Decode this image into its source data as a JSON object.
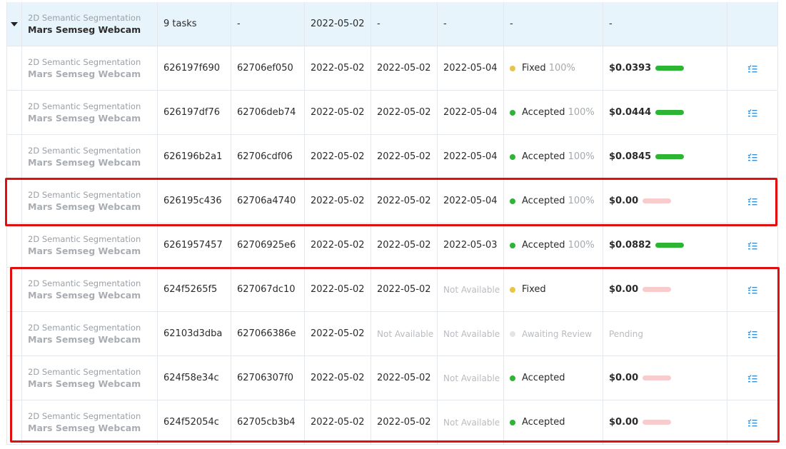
{
  "group": {
    "project_type": "2D Semantic Segmentation",
    "project_name": "Mars Semseg Webcam",
    "tasks": "9 tasks",
    "c3": "-",
    "created": "2022-05-02",
    "c5": "-",
    "c6": "-",
    "c7": "-",
    "c8": "-"
  },
  "rows": [
    {
      "project_type": "2D Semantic Segmentation",
      "project_name": "Mars Semseg Webcam",
      "task_id": "626197f690",
      "annotation_id": "62706ef050",
      "created": "2022-05-02",
      "submitted": "2022-05-02",
      "reviewed": "2022-05-04",
      "status": "Fixed",
      "percent": "100%",
      "status_color": "#e8c547",
      "price": "$0.0393",
      "bar_fill": 1,
      "bar_color": "#2bb532"
    },
    {
      "project_type": "2D Semantic Segmentation",
      "project_name": "Mars Semseg Webcam",
      "task_id": "626197df76",
      "annotation_id": "62706deb74",
      "created": "2022-05-02",
      "submitted": "2022-05-02",
      "reviewed": "2022-05-04",
      "status": "Accepted",
      "percent": "100%",
      "status_color": "#2bb532",
      "price": "$0.0444",
      "bar_fill": 1,
      "bar_color": "#2bb532"
    },
    {
      "project_type": "2D Semantic Segmentation",
      "project_name": "Mars Semseg Webcam",
      "task_id": "626196b2a1",
      "annotation_id": "62706cdf06",
      "created": "2022-05-02",
      "submitted": "2022-05-02",
      "reviewed": "2022-05-04",
      "status": "Accepted",
      "percent": "100%",
      "status_color": "#2bb532",
      "price": "$0.0845",
      "bar_fill": 1,
      "bar_color": "#2bb532"
    },
    {
      "project_type": "2D Semantic Segmentation",
      "project_name": "Mars Semseg Webcam",
      "task_id": "626195c436",
      "annotation_id": "62706a4740",
      "created": "2022-05-02",
      "submitted": "2022-05-02",
      "reviewed": "2022-05-04",
      "status": "Accepted",
      "percent": "100%",
      "status_color": "#2bb532",
      "price": "$0.00",
      "bar_fill": 1,
      "bar_color": "#f8cccc"
    },
    {
      "project_type": "2D Semantic Segmentation",
      "project_name": "Mars Semseg Webcam",
      "task_id": "6261957457",
      "annotation_id": "62706925e6",
      "created": "2022-05-02",
      "submitted": "2022-05-02",
      "reviewed": "2022-05-03",
      "status": "Accepted",
      "percent": "100%",
      "status_color": "#2bb532",
      "price": "$0.0882",
      "bar_fill": 1,
      "bar_color": "#2bb532"
    },
    {
      "project_type": "2D Semantic Segmentation",
      "project_name": "Mars Semseg Webcam",
      "task_id": "624f5265f5",
      "annotation_id": "627067dc10",
      "created": "2022-05-02",
      "submitted": "2022-05-02",
      "reviewed": "Not Available",
      "status": "Fixed",
      "percent": "",
      "status_color": "#e8c547",
      "price": "$0.00",
      "bar_fill": 1,
      "bar_color": "#f8cccc"
    },
    {
      "project_type": "2D Semantic Segmentation",
      "project_name": "Mars Semseg Webcam",
      "task_id": "62103d3dba",
      "annotation_id": "627066386e",
      "created": "2022-05-02",
      "submitted": "Not Available",
      "reviewed": "Not Available",
      "status": "Awaiting Review",
      "percent": "",
      "status_color": "#e4e4e4",
      "status_muted": true,
      "price": "Pending",
      "price_muted": true,
      "bar_fill": 0,
      "bar_color": ""
    },
    {
      "project_type": "2D Semantic Segmentation",
      "project_name": "Mars Semseg Webcam",
      "task_id": "624f58e34c",
      "annotation_id": "62706307f0",
      "created": "2022-05-02",
      "submitted": "2022-05-02",
      "reviewed": "Not Available",
      "status": "Accepted",
      "percent": "",
      "status_color": "#2bb532",
      "price": "$0.00",
      "bar_fill": 1,
      "bar_color": "#f8cccc"
    },
    {
      "project_type": "2D Semantic Segmentation",
      "project_name": "Mars Semseg Webcam",
      "task_id": "624f52054c",
      "annotation_id": "62705cb3b4",
      "created": "2022-05-02",
      "submitted": "2022-05-02",
      "reviewed": "Not Available",
      "status": "Accepted",
      "percent": "",
      "status_color": "#2bb532",
      "price": "$0.00",
      "bar_fill": 1,
      "bar_color": "#f8cccc"
    }
  ],
  "icons": {
    "expand": "caret-down-icon",
    "row_action": "checklist-icon"
  },
  "colors": {
    "group_bg": "#e8f4fc",
    "highlight": "#e01010",
    "icon": "#3a8fd0"
  }
}
